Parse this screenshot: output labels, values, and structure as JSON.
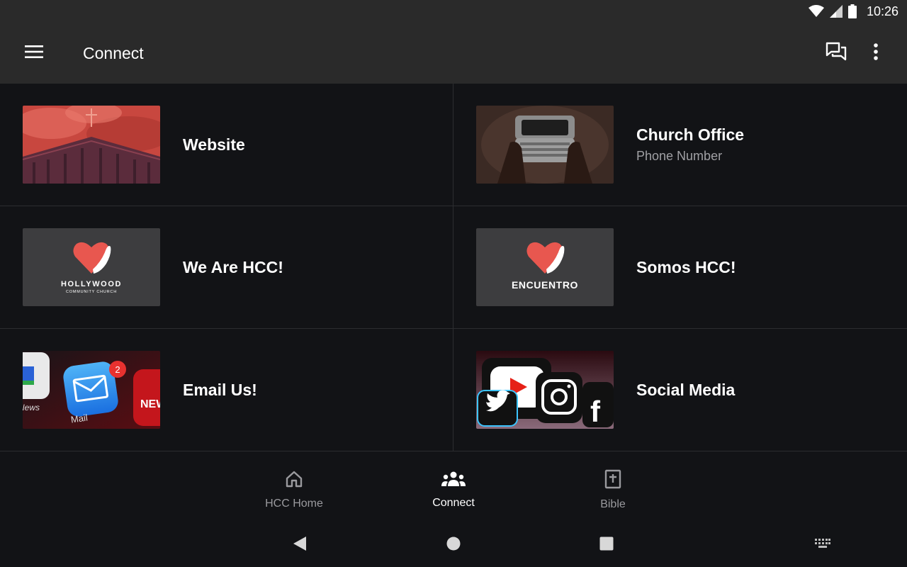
{
  "status": {
    "time": "10:26"
  },
  "appbar": {
    "title": "Connect"
  },
  "items": [
    {
      "title": "Website",
      "subtitle": ""
    },
    {
      "title": "Church Office",
      "subtitle": "Phone Number"
    },
    {
      "title": "We Are HCC!",
      "subtitle": "",
      "logo_line1": "HOLLYWOOD",
      "logo_line2": "COMMUNITY CHURCH"
    },
    {
      "title": "Somos HCC!",
      "subtitle": "",
      "logo_line1": "ENCUENTRO"
    },
    {
      "title": "Email Us!",
      "subtitle": "",
      "badge": "2",
      "app_label_1": "Mail",
      "app_label_2": "News",
      "app_label_3": "NEW"
    },
    {
      "title": "Social Media",
      "subtitle": ""
    }
  ],
  "bottom_nav": [
    {
      "label": "HCC Home",
      "icon": "home-icon"
    },
    {
      "label": "Connect",
      "icon": "people-icon",
      "active": true
    },
    {
      "label": "Bible",
      "icon": "bible-icon"
    }
  ],
  "colors": {
    "accent_red": "#e8574f",
    "bar_bg": "#2a2a2a",
    "page_bg": "#121316"
  }
}
